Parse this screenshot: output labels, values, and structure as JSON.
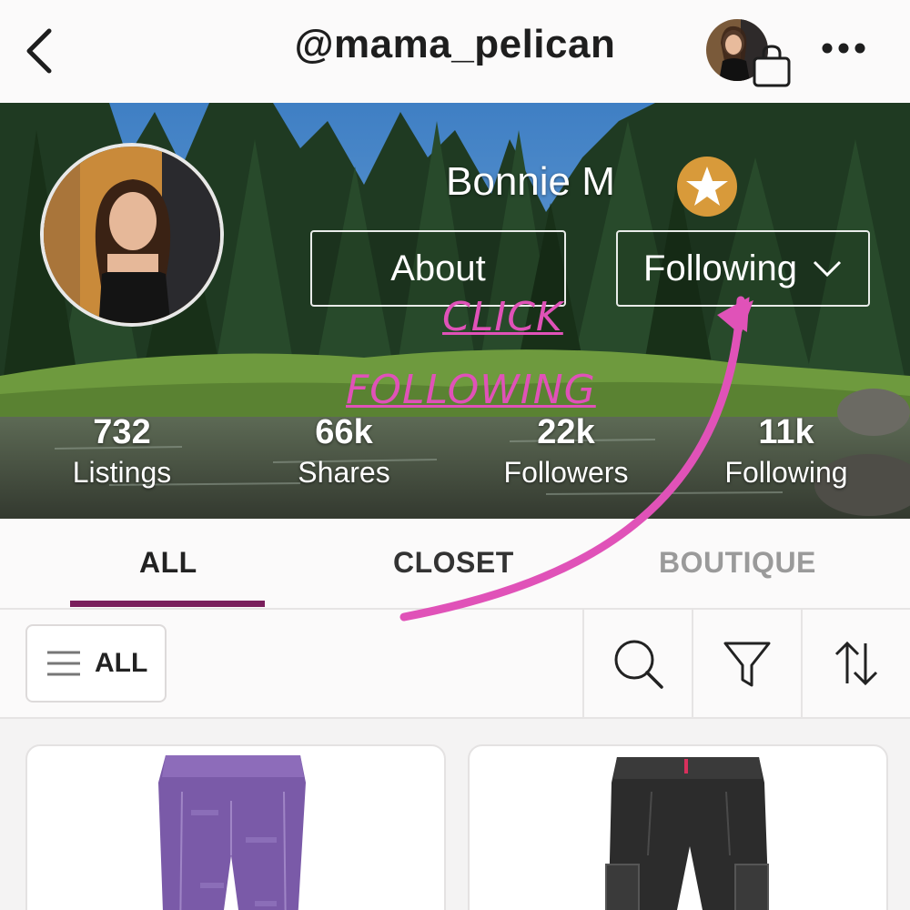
{
  "header": {
    "handle": "@mama_pelican",
    "back_icon": "chevron-left-icon",
    "bag_icon": "shopping-bag-icon",
    "more_icon": "ellipsis-icon"
  },
  "profile": {
    "name": "Bonnie M",
    "badge_icon": "star-badge-icon",
    "about_label": "About",
    "following_label": "Following",
    "stats": [
      {
        "value": "732",
        "label": "Listings"
      },
      {
        "value": "66k",
        "label": "Shares"
      },
      {
        "value": "22k",
        "label": "Followers"
      },
      {
        "value": "11k",
        "label": "Following"
      }
    ]
  },
  "tabs": {
    "items": [
      {
        "label": "ALL",
        "active": true
      },
      {
        "label": "CLOSET",
        "active": false
      },
      {
        "label": "BOUTIQUE",
        "active": false
      }
    ],
    "accent": "#7a1f5c"
  },
  "toolbar": {
    "filter_label": "ALL",
    "icons": [
      "search-icon",
      "filter-icon",
      "sort-icon"
    ]
  },
  "annotation": {
    "line1": "CLICK",
    "line2": "FOLLOWING",
    "color": "#e052b8"
  },
  "listings": [
    {
      "item": "purple leggings"
    },
    {
      "item": "black cargo pants"
    }
  ]
}
